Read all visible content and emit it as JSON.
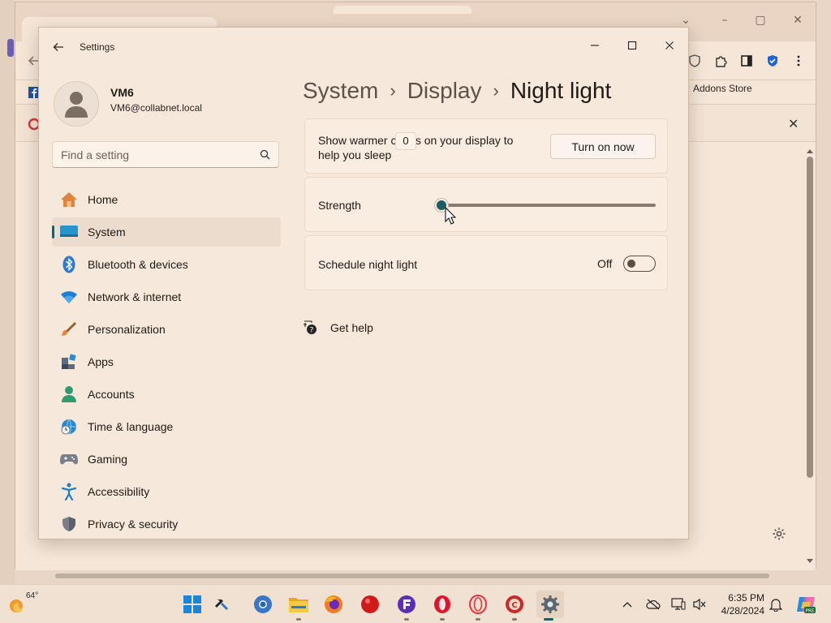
{
  "settings": {
    "title": "Settings",
    "profile": {
      "name": "VM6",
      "email": "VM6@collabnet.local"
    },
    "search_placeholder": "Find a setting",
    "nav": [
      {
        "label": "Home",
        "icon": "home-icon"
      },
      {
        "label": "System",
        "icon": "system-icon",
        "active": true
      },
      {
        "label": "Bluetooth & devices",
        "icon": "bluetooth-icon"
      },
      {
        "label": "Network & internet",
        "icon": "wifi-icon"
      },
      {
        "label": "Personalization",
        "icon": "brush-icon"
      },
      {
        "label": "Apps",
        "icon": "apps-icon"
      },
      {
        "label": "Accounts",
        "icon": "accounts-icon"
      },
      {
        "label": "Time & language",
        "icon": "globe-clock-icon"
      },
      {
        "label": "Gaming",
        "icon": "gamepad-icon"
      },
      {
        "label": "Accessibility",
        "icon": "accessibility-icon"
      },
      {
        "label": "Privacy & security",
        "icon": "shield-icon"
      }
    ],
    "breadcrumb": {
      "level1": "System",
      "level2": "Display",
      "current": "Night light"
    },
    "night_light": {
      "description_line1": "Show warmer colors on your display to",
      "description_line2": "help you sleep",
      "turn_on_label": "Turn on now"
    },
    "strength": {
      "label": "Strength",
      "value": 0,
      "value_text": "0"
    },
    "schedule": {
      "label": "Schedule night light",
      "state_label": "Off",
      "enabled": false
    },
    "get_help": "Get help"
  },
  "browser": {
    "addons_label": "Addons Store"
  },
  "taskbar": {
    "weather_temp": "64°",
    "time": "6:35 PM",
    "date": "4/28/2024",
    "apps": [
      "windows-start-icon",
      "hammer-icon",
      "chrome-icon",
      "file-explorer-icon",
      "firefox-icon",
      "red-circle-app-icon",
      "f-app-icon",
      "opera-icon",
      "opera-gx-icon",
      "cc-app-icon",
      "settings-gear-icon"
    ]
  },
  "colors": {
    "accent": "#1f5b63",
    "background": "#f6e8da"
  }
}
